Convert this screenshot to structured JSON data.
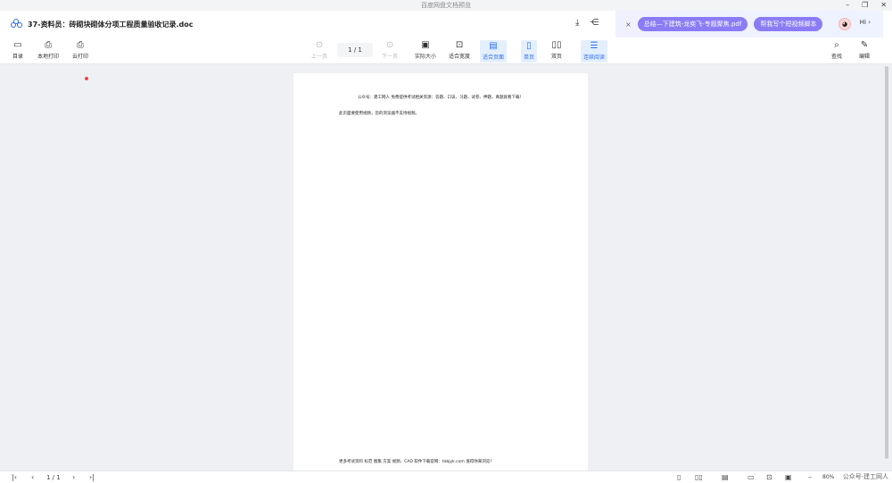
{
  "window": {
    "title": "百度网盘文档预览",
    "controls": [
      "–",
      "❐",
      "✕"
    ]
  },
  "header": {
    "doc_title": "37-资料员：砖砌块砌体分项工程质量验收记录.doc",
    "download_icon": "download-icon",
    "share_icon": "share-icon"
  },
  "ai_bar": {
    "close": "×",
    "pill1": "总结—下建筑-龙奕飞-专题聚焦.pdf",
    "pill2": "帮我写个短视频脚本",
    "hi": "Hi ›"
  },
  "toolbar": {
    "contents": "目录",
    "local_print": "本地打印",
    "cloud_print": "云打印",
    "prev": "上一页",
    "page": "1 / 1",
    "next": "下一页",
    "actual": "实际大小",
    "fit_width": "适合宽度",
    "fit_page": "适合页面",
    "single": "单页",
    "double": "双页",
    "continuous": "连续阅读",
    "search": "查找",
    "edit": "编辑"
  },
  "document": {
    "header_line": "公众号：建工网人 免费提供考试相关资源：答题、口诀、习题、试卷、押题，真题就看下载！",
    "line1": "此页面要使用视频，您的浏览器不支持视频。",
    "footer": "更多考试资料 标范 图集 方案 视频、CAD 软件下载官网：tobjyk.com 值得你来浏览！"
  },
  "status": {
    "page": "1 / 1",
    "zoom": "80%",
    "minus": "–",
    "watermark": "公众号·建工网人"
  }
}
